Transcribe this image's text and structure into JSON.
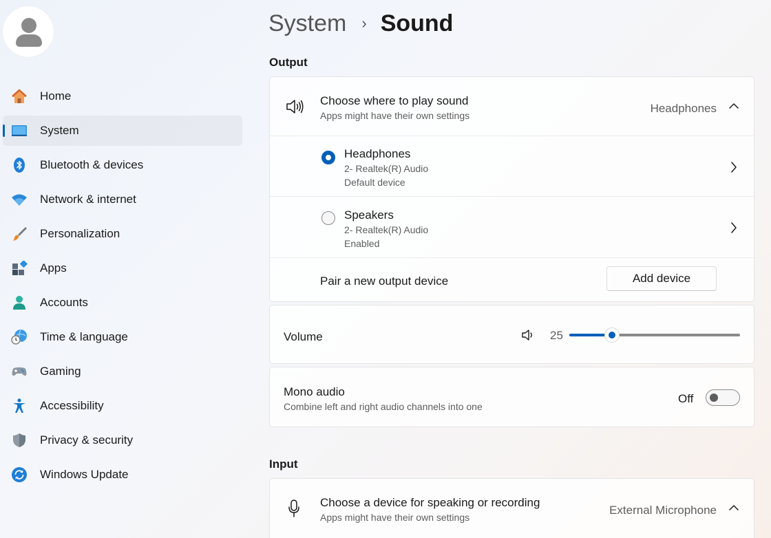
{
  "breadcrumb": {
    "parent": "System",
    "separator": "›",
    "current": "Sound"
  },
  "sidebar": {
    "items": [
      {
        "label": "Home",
        "icon": "home-icon"
      },
      {
        "label": "System",
        "icon": "system-icon",
        "selected": true
      },
      {
        "label": "Bluetooth & devices",
        "icon": "bluetooth-icon"
      },
      {
        "label": "Network & internet",
        "icon": "wifi-icon"
      },
      {
        "label": "Personalization",
        "icon": "brush-icon"
      },
      {
        "label": "Apps",
        "icon": "apps-icon"
      },
      {
        "label": "Accounts",
        "icon": "accounts-icon"
      },
      {
        "label": "Time & language",
        "icon": "time-language-icon"
      },
      {
        "label": "Gaming",
        "icon": "gaming-icon"
      },
      {
        "label": "Accessibility",
        "icon": "accessibility-icon"
      },
      {
        "label": "Privacy & security",
        "icon": "shield-icon"
      },
      {
        "label": "Windows Update",
        "icon": "update-icon"
      }
    ]
  },
  "output": {
    "section_title": "Output",
    "choose": {
      "title": "Choose where to play sound",
      "subtitle": "Apps might have their own settings",
      "value": "Headphones"
    },
    "devices": [
      {
        "name": "Headphones",
        "line1": "2- Realtek(R) Audio",
        "line2": "Default device",
        "checked": true
      },
      {
        "name": "Speakers",
        "line1": "2- Realtek(R) Audio",
        "line2": "Enabled",
        "checked": false
      }
    ],
    "pair": {
      "title": "Pair a new output device",
      "button": "Add device"
    },
    "volume": {
      "label": "Volume",
      "value_text": "25",
      "value": 25,
      "max": 100
    },
    "mono": {
      "title": "Mono audio",
      "subtitle": "Combine left and right audio channels into one",
      "state": "Off"
    }
  },
  "input": {
    "section_title": "Input",
    "choose": {
      "title": "Choose a device for speaking or recording",
      "subtitle": "Apps might have their own settings",
      "value": "External Microphone"
    }
  },
  "colors": {
    "accent": "#005fb8"
  }
}
